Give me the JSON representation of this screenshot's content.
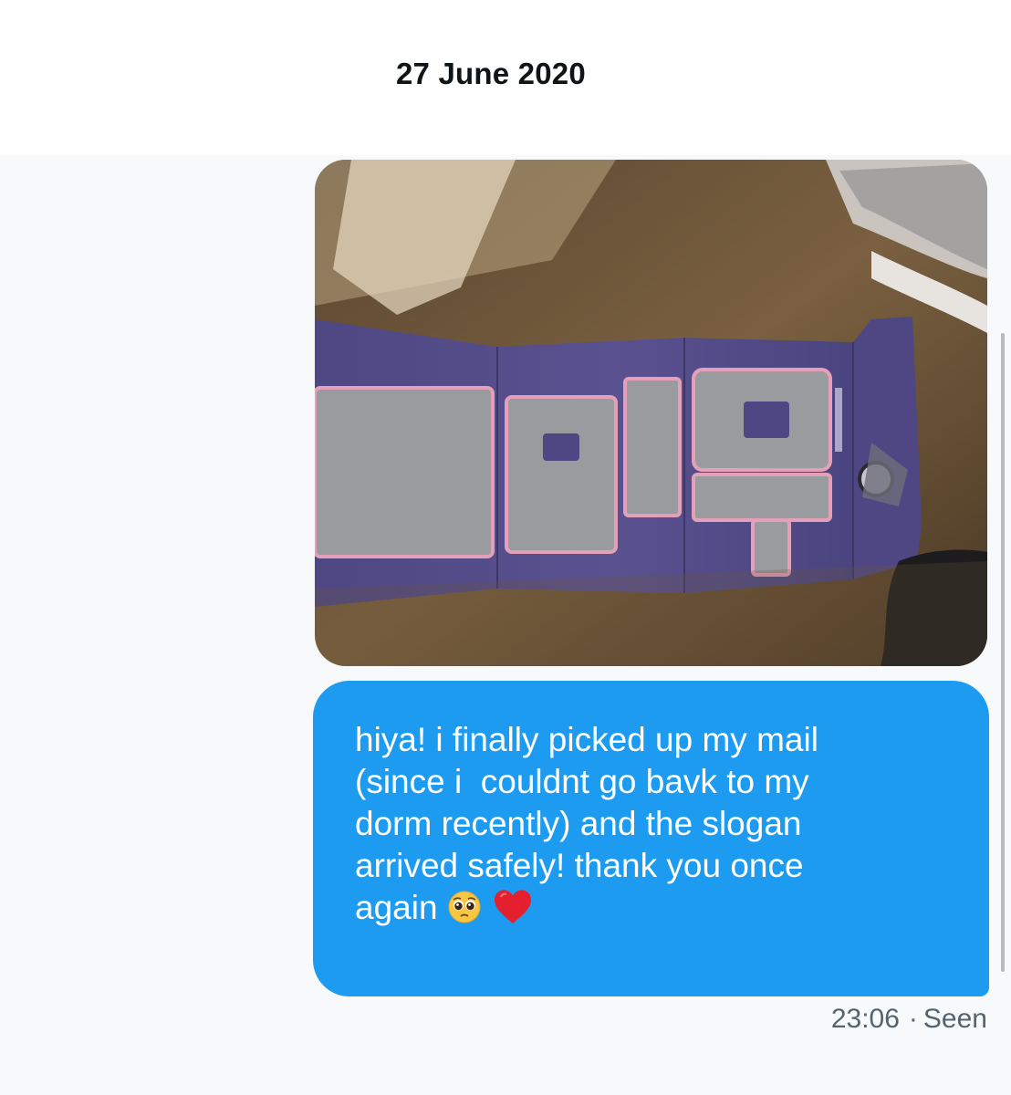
{
  "conversation": {
    "date_divider": "27 June 2020",
    "message": {
      "text": "hiya! i finally picked up my mail\n(since i  couldnt go bavk to my\ndorm recently) and the slogan\narrived safely! thank you once\nagain",
      "emojis": [
        "pleading-face-emoji",
        "red-heart-emoji"
      ],
      "time": "23:06",
      "separator": "·",
      "status": "Seen"
    },
    "attachment": {
      "type": "photo",
      "icon": "photo-of-purple-slogan-banner"
    }
  },
  "colors": {
    "bubble": "#1d9bf0",
    "bubble_text": "#ffffff",
    "meta_text": "#536471",
    "thread_background": "#f7f9fb",
    "date_text": "#0f1419"
  }
}
